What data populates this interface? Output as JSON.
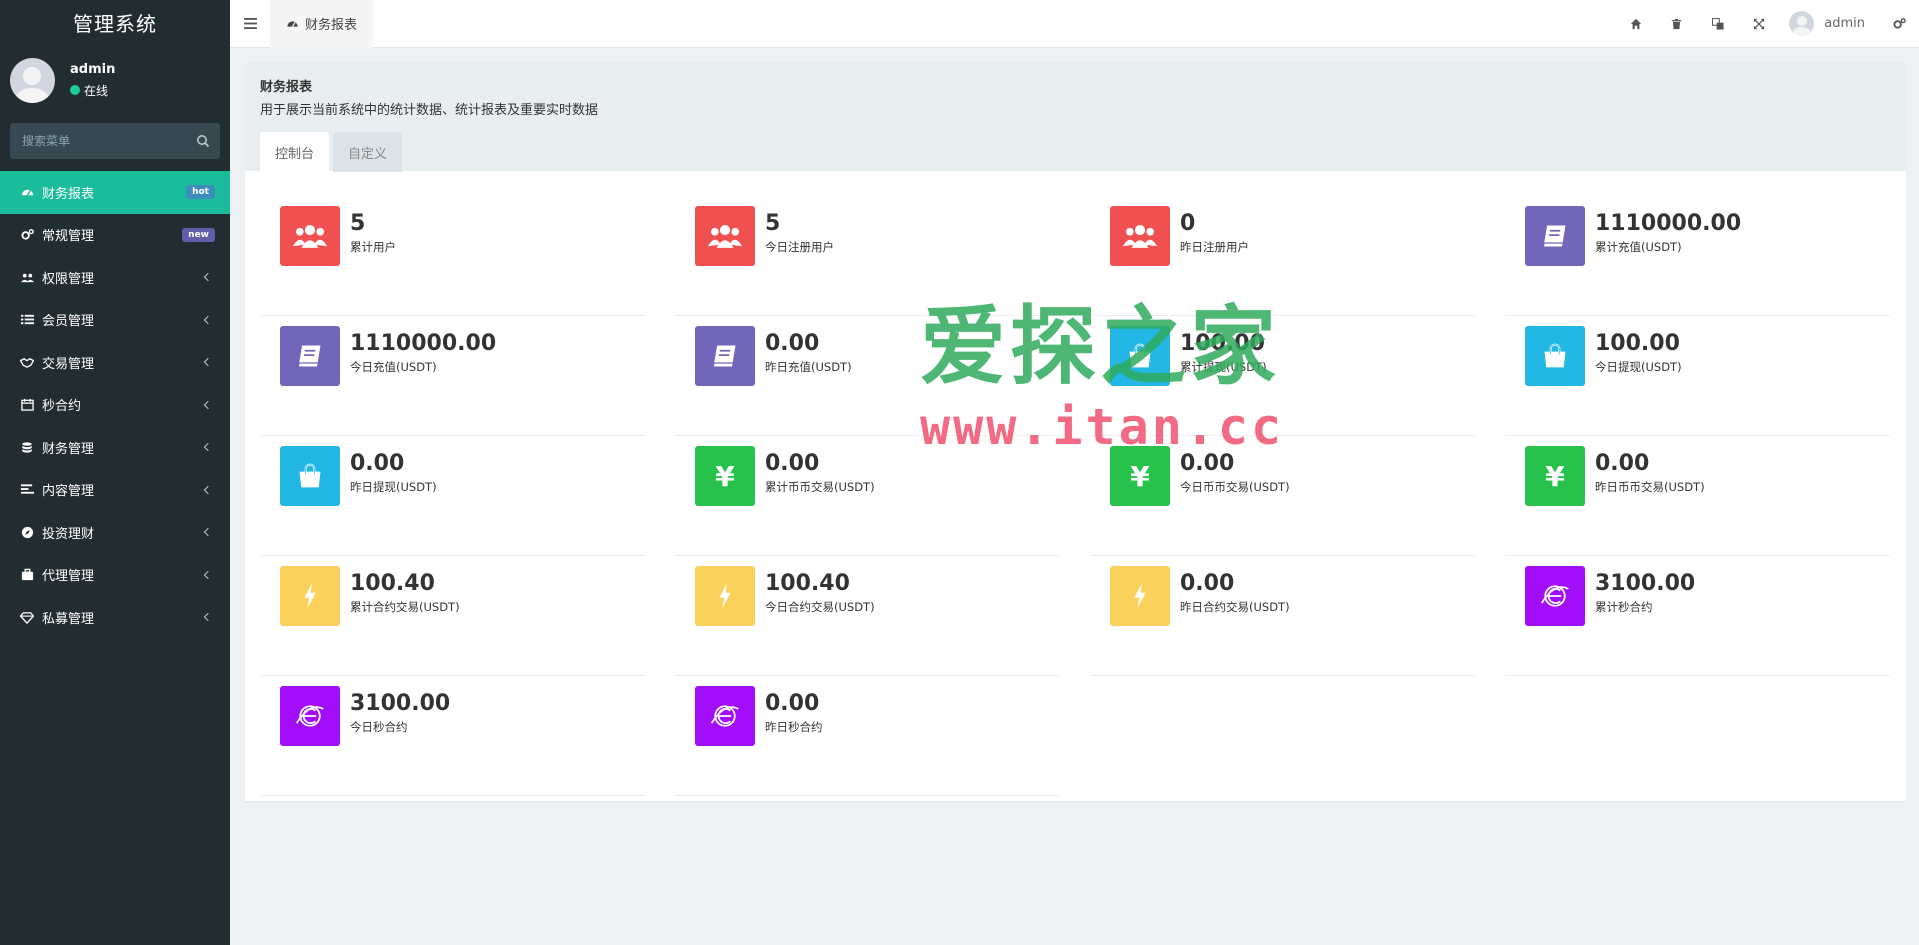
{
  "app": {
    "title": "管理系统"
  },
  "user": {
    "name": "admin",
    "status": "在线"
  },
  "search": {
    "placeholder": "搜索菜单"
  },
  "menu": [
    {
      "label": "财务报表",
      "badge": "hot",
      "active": true,
      "icon": "dashboard-icon"
    },
    {
      "label": "常规管理",
      "badge": "new",
      "icon": "cogs-icon"
    },
    {
      "label": "权限管理",
      "icon": "group-icon"
    },
    {
      "label": "会员管理",
      "icon": "list-icon"
    },
    {
      "label": "交易管理",
      "icon": "handshake-icon"
    },
    {
      "label": "秒合约",
      "icon": "calendar-icon"
    },
    {
      "label": "财务管理",
      "icon": "database-icon"
    },
    {
      "label": "内容管理",
      "icon": "align-left-icon"
    },
    {
      "label": "投资理财",
      "icon": "compass-icon"
    },
    {
      "label": "代理管理",
      "icon": "briefcase-icon"
    },
    {
      "label": "私募管理",
      "icon": "diamond-icon"
    }
  ],
  "topbar": {
    "active_tab": "财务报表",
    "user_name": "admin"
  },
  "page": {
    "title": "财务报表",
    "description": "用于展示当前系统中的统计数据、统计报表及重要实时数据",
    "tabs": [
      "控制台",
      "自定义"
    ]
  },
  "stats": [
    {
      "value": "5",
      "label": "累计用户",
      "color": "#f05050",
      "icon": "users-icon"
    },
    {
      "value": "5",
      "label": "今日注册用户",
      "color": "#f05050",
      "icon": "users-icon"
    },
    {
      "value": "0",
      "label": "昨日注册用户",
      "color": "#f05050",
      "icon": "users-icon"
    },
    {
      "value": "1110000.00",
      "label": "累计充值(USDT)",
      "color": "#7266ba",
      "icon": "book-icon"
    },
    {
      "value": "1110000.00",
      "label": "今日充值(USDT)",
      "color": "#7266ba",
      "icon": "book-icon"
    },
    {
      "value": "0.00",
      "label": "昨日充值(USDT)",
      "color": "#7266ba",
      "icon": "book-icon"
    },
    {
      "value": "100.00",
      "label": "累计提现(USDT)",
      "color": "#23b7e5",
      "icon": "shopping-bag-icon"
    },
    {
      "value": "100.00",
      "label": "今日提现(USDT)",
      "color": "#23b7e5",
      "icon": "shopping-bag-icon"
    },
    {
      "value": "0.00",
      "label": "昨日提现(USDT)",
      "color": "#23b7e5",
      "icon": "shopping-bag-icon"
    },
    {
      "value": "0.00",
      "label": "累计币币交易(USDT)",
      "color": "#27c24c",
      "icon": "yen-icon",
      "glyph": "¥"
    },
    {
      "value": "0.00",
      "label": "今日币币交易(USDT)",
      "color": "#27c24c",
      "icon": "yen-icon",
      "glyph": "¥"
    },
    {
      "value": "0.00",
      "label": "昨日币币交易(USDT)",
      "color": "#27c24c",
      "icon": "yen-icon",
      "glyph": "¥"
    },
    {
      "value": "100.40",
      "label": "累计合约交易(USDT)",
      "color": "#fad25b",
      "icon": "bolt-icon"
    },
    {
      "value": "100.40",
      "label": "今日合约交易(USDT)",
      "color": "#fad25b",
      "icon": "bolt-icon"
    },
    {
      "value": "0.00",
      "label": "昨日合约交易(USDT)",
      "color": "#fad25b",
      "icon": "bolt-icon"
    },
    {
      "value": "3100.00",
      "label": "累计秒合约",
      "color": "#a20dfa",
      "icon": "explorer-icon"
    },
    {
      "value": "3100.00",
      "label": "今日秒合约",
      "color": "#a20dfa",
      "icon": "explorer-icon"
    },
    {
      "value": "0.00",
      "label": "昨日秒合约",
      "color": "#a20dfa",
      "icon": "explorer-icon"
    }
  ],
  "watermark": {
    "text": "爱探之家",
    "url": "www.itan.cc"
  }
}
